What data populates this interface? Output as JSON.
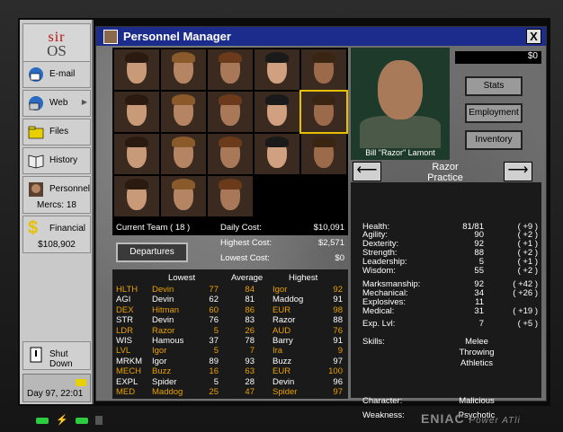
{
  "os": {
    "brand_top": "sir",
    "brand_bottom": "OS"
  },
  "sidebar": {
    "items": [
      {
        "label": "E-mail",
        "icon": "email-icon"
      },
      {
        "label": "Web",
        "icon": "web-icon"
      },
      {
        "label": "Files",
        "icon": "folder-icon"
      },
      {
        "label": "History",
        "icon": "book-icon"
      },
      {
        "label": "Personnel",
        "sub": "Mercs: 18",
        "icon": "personnel-icon"
      },
      {
        "label": "Financial",
        "sub": "$108,902",
        "icon": "dollar-icon"
      },
      {
        "label": "Shut Down",
        "icon": "shutdown-icon"
      }
    ],
    "date": "Day 97, 22:01"
  },
  "window": {
    "title": "Personnel Manager",
    "close": "X",
    "balance": "$0",
    "buttons": [
      "Stats",
      "Employment",
      "Inventory"
    ],
    "selected_name": "Bill \"Razor\" Lamont",
    "assignment_line1": "Razor",
    "assignment_line2": "Practice"
  },
  "team": {
    "current_label": "Current Team",
    "current_value": "( 18 )",
    "daily_label": "Daily Cost:",
    "daily_value": "$10,091",
    "highest_label": "Highest Cost:",
    "highest_value": "$2,571",
    "lowest_label": "Lowest Cost:",
    "lowest_value": "$0",
    "departures": "Departures"
  },
  "table": {
    "headers": [
      "Lowest",
      "Average",
      "Highest"
    ],
    "rows": [
      {
        "stat": "HLTH",
        "hl": true,
        "low_name": "Devin",
        "low": "77",
        "avg": "84",
        "high_name": "Igor",
        "high": "92"
      },
      {
        "stat": "AGI",
        "hl": false,
        "low_name": "Devin",
        "low": "62",
        "avg": "81",
        "high_name": "Maddog",
        "high": "91"
      },
      {
        "stat": "DEX",
        "hl": true,
        "low_name": "Hitman",
        "low": "60",
        "avg": "86",
        "high_name": "EUR",
        "high": "98"
      },
      {
        "stat": "STR",
        "hl": false,
        "low_name": "Devin",
        "low": "76",
        "avg": "83",
        "high_name": "Razor",
        "high": "88"
      },
      {
        "stat": "LDR",
        "hl": true,
        "low_name": "Razor",
        "low": "5",
        "avg": "26",
        "high_name": "AUD",
        "high": "76"
      },
      {
        "stat": "WIS",
        "hl": false,
        "low_name": "Hamous",
        "low": "37",
        "avg": "78",
        "high_name": "Barry",
        "high": "91"
      },
      {
        "stat": "LVL",
        "hl": true,
        "low_name": "Igor",
        "low": "5",
        "avg": "7",
        "high_name": "Ira",
        "high": "9"
      },
      {
        "stat": "MRKM",
        "hl": false,
        "low_name": "Igor",
        "low": "89",
        "avg": "93",
        "high_name": "Buzz",
        "high": "97"
      },
      {
        "stat": "MECH",
        "hl": true,
        "low_name": "Buzz",
        "low": "16",
        "avg": "63",
        "high_name": "EUR",
        "high": "100"
      },
      {
        "stat": "EXPL",
        "hl": false,
        "low_name": "Spider",
        "low": "5",
        "avg": "28",
        "high_name": "Devin",
        "high": "96"
      },
      {
        "stat": "MED",
        "hl": true,
        "low_name": "Maddog",
        "low": "25",
        "avg": "47",
        "high_name": "Spider",
        "high": "97"
      }
    ]
  },
  "stats": {
    "rows": [
      {
        "k": "Health:",
        "v": "81/81",
        "b": "( +9 )"
      },
      {
        "k": "Agility:",
        "v": "90",
        "b": "( +2 )"
      },
      {
        "k": "Dexterity:",
        "v": "92",
        "b": "( +1 )"
      },
      {
        "k": "Strength:",
        "v": "88",
        "b": "( +2 )"
      },
      {
        "k": "Leadership:",
        "v": "5",
        "b": "( +1 )"
      },
      {
        "k": "Wisdom:",
        "v": "55",
        "b": "( +2 )"
      },
      {
        "k": "Marksmanship:",
        "v": "92",
        "b": "( +42 )"
      },
      {
        "k": "Mechanical:",
        "v": "34",
        "b": "( +26 )"
      },
      {
        "k": "Explosives:",
        "v": "11",
        "b": ""
      },
      {
        "k": "Medical:",
        "v": "31",
        "b": "( +19 )"
      },
      {
        "k": "Exp. Lvl:",
        "v": "7",
        "b": "( +5 )"
      }
    ],
    "skills_label": "Skills:",
    "skills": [
      "Melee",
      "Throwing",
      "Athletics"
    ],
    "character_label": "Character:",
    "character": "Malicious",
    "weakness_label": "Weakness:",
    "weakness": "Psychotic"
  },
  "footer": {
    "brand": "ENIAC",
    "model": "Power ATli"
  }
}
